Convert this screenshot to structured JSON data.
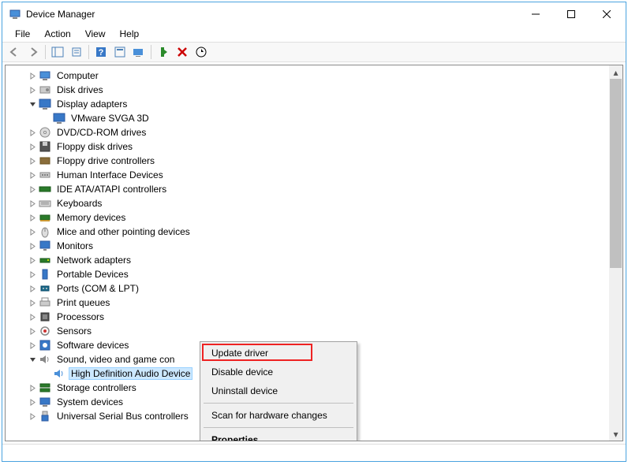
{
  "window": {
    "title": "Device Manager"
  },
  "menubar": [
    "File",
    "Action",
    "View",
    "Help"
  ],
  "tree": {
    "items": [
      {
        "label": "Computer",
        "icon": "computer",
        "expander": "right"
      },
      {
        "label": "Disk drives",
        "icon": "disk",
        "expander": "right"
      },
      {
        "label": "Display adapters",
        "icon": "display",
        "expander": "down",
        "children": [
          {
            "label": "VMware SVGA 3D",
            "icon": "display"
          }
        ]
      },
      {
        "label": "DVD/CD-ROM drives",
        "icon": "dvd",
        "expander": "right"
      },
      {
        "label": "Floppy disk drives",
        "icon": "floppy",
        "expander": "right"
      },
      {
        "label": "Floppy drive controllers",
        "icon": "floppyctl",
        "expander": "right"
      },
      {
        "label": "Human Interface Devices",
        "icon": "hid",
        "expander": "right"
      },
      {
        "label": "IDE ATA/ATAPI controllers",
        "icon": "ide",
        "expander": "right"
      },
      {
        "label": "Keyboards",
        "icon": "keyboard",
        "expander": "right"
      },
      {
        "label": "Memory devices",
        "icon": "memory",
        "expander": "right"
      },
      {
        "label": "Mice and other pointing devices",
        "icon": "mouse",
        "expander": "right"
      },
      {
        "label": "Monitors",
        "icon": "monitor",
        "expander": "right"
      },
      {
        "label": "Network adapters",
        "icon": "network",
        "expander": "right"
      },
      {
        "label": "Portable Devices",
        "icon": "portable",
        "expander": "right"
      },
      {
        "label": "Ports (COM & LPT)",
        "icon": "ports",
        "expander": "right"
      },
      {
        "label": "Print queues",
        "icon": "printer",
        "expander": "right"
      },
      {
        "label": "Processors",
        "icon": "cpu",
        "expander": "right"
      },
      {
        "label": "Sensors",
        "icon": "sensor",
        "expander": "right"
      },
      {
        "label": "Software devices",
        "icon": "software",
        "expander": "right"
      },
      {
        "label": "Sound, video and game controllers",
        "icon": "sound",
        "expander": "down",
        "truncated": "Sound, video and game con",
        "children": [
          {
            "label": "High Definition Audio Device",
            "icon": "speaker",
            "selected": true
          }
        ]
      },
      {
        "label": "Storage controllers",
        "icon": "storage",
        "expander": "right"
      },
      {
        "label": "System devices",
        "icon": "system",
        "expander": "right"
      },
      {
        "label": "Universal Serial Bus controllers",
        "icon": "usb",
        "expander": "right"
      }
    ]
  },
  "context_menu": {
    "items": [
      {
        "label": "Update driver",
        "highlighted": true
      },
      {
        "label": "Disable device"
      },
      {
        "label": "Uninstall device"
      },
      {
        "sep": true
      },
      {
        "label": "Scan for hardware changes"
      },
      {
        "sep": true
      },
      {
        "label": "Properties",
        "bold": true
      }
    ]
  }
}
